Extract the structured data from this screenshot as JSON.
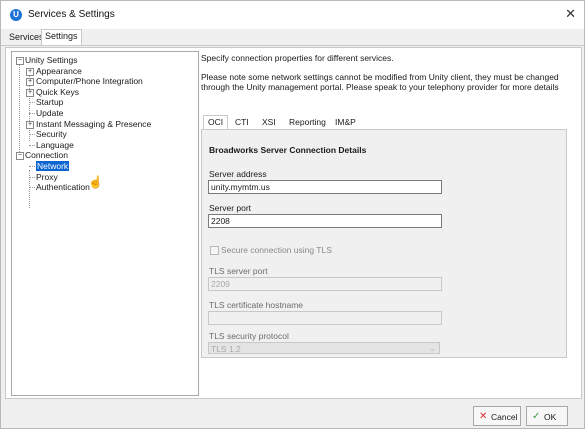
{
  "window": {
    "title": "Services & Settings",
    "app_icon": "U"
  },
  "top_tabs": [
    "Services",
    "Settings"
  ],
  "tree": [
    {
      "label": "Unity Settings",
      "level": 0,
      "exp": "-"
    },
    {
      "label": "Appearance",
      "level": 1,
      "exp": "+"
    },
    {
      "label": "Computer/Phone Integration",
      "level": 1,
      "exp": "+"
    },
    {
      "label": "Quick Keys",
      "level": 1,
      "exp": "+"
    },
    {
      "label": "Startup",
      "level": 1,
      "exp": ""
    },
    {
      "label": "Update",
      "level": 1,
      "exp": ""
    },
    {
      "label": "Instant Messaging & Presence",
      "level": 1,
      "exp": "+"
    },
    {
      "label": "Security",
      "level": 1,
      "exp": ""
    },
    {
      "label": "Language",
      "level": 1,
      "exp": ""
    },
    {
      "label": "Connection",
      "level": 0,
      "exp": "-"
    },
    {
      "label": "Network",
      "level": 1,
      "exp": "",
      "selected": true
    },
    {
      "label": "Proxy",
      "level": 1,
      "exp": ""
    },
    {
      "label": "Authentication",
      "level": 1,
      "exp": ""
    }
  ],
  "description": "Specify connection properties for different services.",
  "note": "Please note some network settings cannot be modified from Unity client, they must be changed through the Unity management portal.  Please speak to your telephony provider for more details",
  "inner_tabs": [
    "OCI",
    "CTI",
    "XSI",
    "Reporting",
    "IM&P"
  ],
  "section_heading": "Broadworks Server Connection Details",
  "server_address": {
    "label": "Server address",
    "value": "unity.mymtm.us"
  },
  "server_port": {
    "label": "Server port",
    "value": "2208"
  },
  "secure_connection": {
    "label": "Secure connection using TLS",
    "checked": false
  },
  "tls_port": {
    "label": "TLS server port",
    "value": "2209"
  },
  "tls_hostname": {
    "label": "TLS certificate hostname",
    "value": ""
  },
  "tls_protocol": {
    "label": "TLS security protocol",
    "value": "TLS 1.2"
  },
  "buttons": {
    "cancel": "Cancel",
    "ok": "OK"
  },
  "colors": {
    "selection": "#0a64d1",
    "cancel_icon": "#d83030",
    "ok_icon": "#3a9a3a",
    "app_icon": "#1e73d8"
  }
}
